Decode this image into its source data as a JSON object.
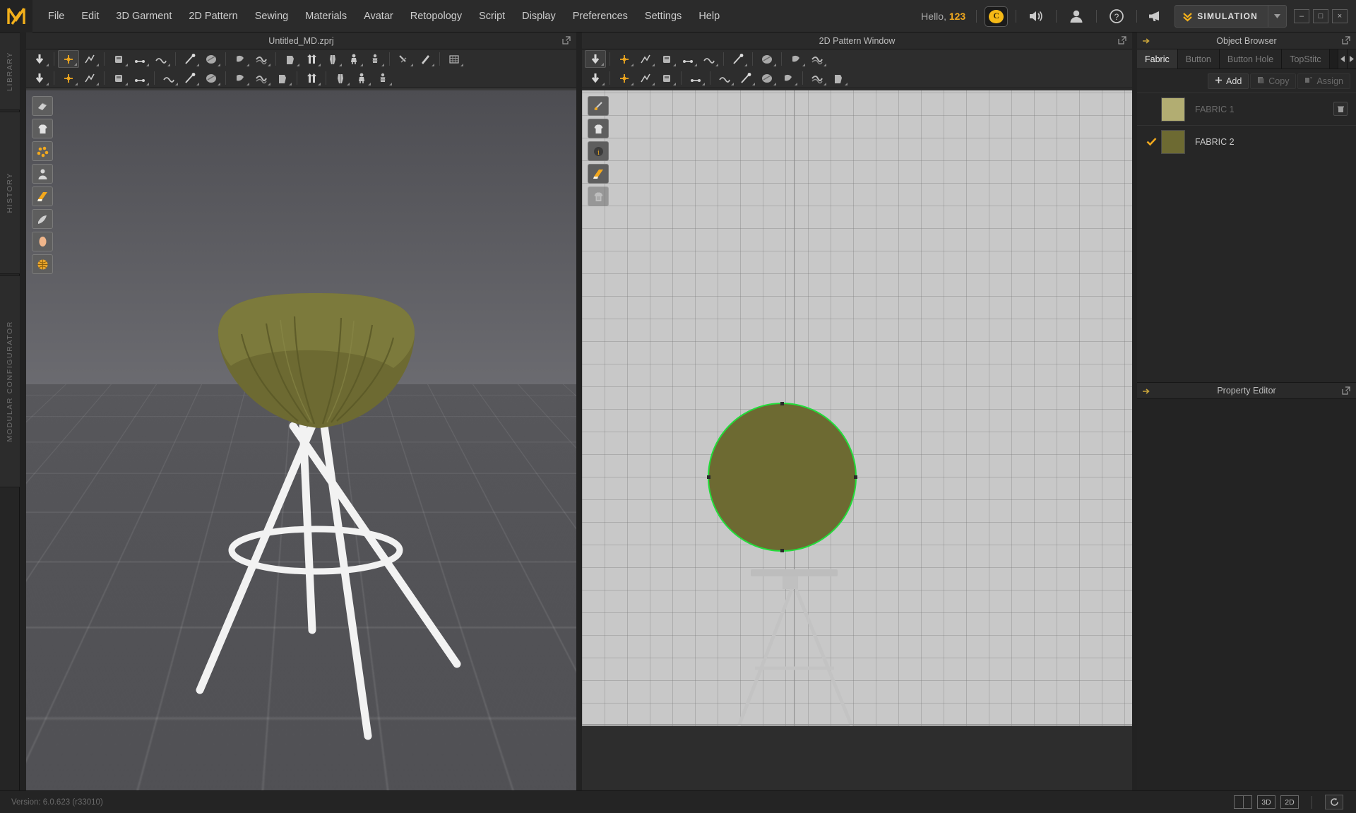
{
  "app": {
    "brand_icon": "marvelous-designer-logo",
    "accent_color": "#f0a81e",
    "version": "Version: 6.0.623 (r33010)"
  },
  "menubar": {
    "items": [
      {
        "label": "File"
      },
      {
        "label": "Edit"
      },
      {
        "label": "3D Garment"
      },
      {
        "label": "2D Pattern"
      },
      {
        "label": "Sewing"
      },
      {
        "label": "Materials"
      },
      {
        "label": "Avatar"
      },
      {
        "label": "Retopology"
      },
      {
        "label": "Script"
      },
      {
        "label": "Display"
      },
      {
        "label": "Preferences"
      },
      {
        "label": "Settings"
      },
      {
        "label": "Help"
      }
    ],
    "greeting_prefix": "Hello,",
    "username": "123",
    "coin_icon": "coin-icon",
    "volume_icon": "speaker-icon",
    "account_icon": "user-icon",
    "help_icon": "question-mark-icon",
    "notice_icon": "megaphone-icon",
    "mode_label": "SIMULATION",
    "mode_icon": "double-chevron-down-icon",
    "mode_dropdown_icon": "caret-down-icon",
    "window_minimize": "–",
    "window_maximize": "□",
    "window_close": "×"
  },
  "left_rail": {
    "tabs": [
      {
        "label": "LIBRARY",
        "name": "rail-library"
      },
      {
        "label": "HISTORY",
        "name": "rail-history"
      },
      {
        "label": "MODULAR CONFIGURATOR",
        "name": "rail-modular"
      }
    ]
  },
  "viewport_3d": {
    "title": "Untitled_MD.zprj",
    "popout_icon": "popout-icon",
    "tool_palette": [
      {
        "name": "show-hide-arrangement-points-icon"
      },
      {
        "name": "show-hide-garment-icon"
      },
      {
        "name": "show-hide-particle-distance-icon"
      },
      {
        "name": "show-hide-avatar-icon"
      },
      {
        "name": "show-hide-texture-surface-icon"
      },
      {
        "name": "show-hide-fabric-icon"
      },
      {
        "name": "show-hide-skin-icon"
      },
      {
        "name": "show-hide-uv-sphere-icon"
      }
    ],
    "toolbar_row1": [
      {
        "name": "simulate-icon"
      },
      {
        "name": "select-move-icon",
        "selected": true
      },
      {
        "name": "select-mesh-icon"
      },
      {
        "name": "pin-icon"
      },
      {
        "name": "fold-arrangement-icon"
      },
      {
        "name": "segment-sewing-icon"
      },
      {
        "name": "tack-icon"
      },
      {
        "name": "pressure-icon"
      },
      {
        "name": "layer-icon"
      },
      {
        "name": "flatten-icon"
      },
      {
        "name": "box-icon"
      },
      {
        "name": "arrow-up-icon"
      },
      {
        "name": "avatar-sizing-icon"
      },
      {
        "name": "avatar-pose-icon"
      },
      {
        "name": "avatar-measure-icon"
      },
      {
        "name": "scissors-icon"
      },
      {
        "name": "brush-icon"
      },
      {
        "name": "grid-icon"
      }
    ],
    "toolbar_row2": [
      {
        "name": "walk-pose-icon"
      },
      {
        "name": "skin-offset-icon"
      },
      {
        "name": "pen-avatar-icon"
      },
      {
        "name": "x-ray-joint-icon"
      },
      {
        "name": "bounding-volume-icon"
      },
      {
        "name": "zipper-icon"
      },
      {
        "name": "button-icon"
      },
      {
        "name": "buttonhole-icon"
      },
      {
        "name": "snap-icon"
      },
      {
        "name": "button-round-icon"
      },
      {
        "name": "lock-button-icon"
      },
      {
        "name": "zipper-slider-icon"
      },
      {
        "name": "plane-icon"
      },
      {
        "name": "ground-plane-icon"
      },
      {
        "name": "uv-editor-icon"
      }
    ]
  },
  "viewport_2d": {
    "title": "2D Pattern Window",
    "popout_icon": "popout-icon",
    "tool_palette": [
      {
        "name": "show-hide-internal-line-icon"
      },
      {
        "name": "show-hide-pattern-icon"
      },
      {
        "name": "show-hide-pattern-info-icon"
      },
      {
        "name": "show-hide-pattern-texture-icon"
      },
      {
        "name": "lock-pattern-icon",
        "disabled": true
      }
    ],
    "toolbar_row1": [
      {
        "name": "edit-pattern-icon",
        "selected": true
      },
      {
        "name": "edit-point-icon"
      },
      {
        "name": "transform-pattern-icon"
      },
      {
        "name": "ellipse-icon"
      },
      {
        "name": "rectangle-icon"
      },
      {
        "name": "polygon-icon"
      },
      {
        "name": "pleat-icon"
      },
      {
        "name": "avatar-link-icon"
      },
      {
        "name": "mesh-edit-icon"
      },
      {
        "name": "grid-pattern-icon"
      }
    ],
    "toolbar_row2": [
      {
        "name": "trace-icon"
      },
      {
        "name": "unfold-icon"
      },
      {
        "name": "symmetric-pattern-icon"
      },
      {
        "name": "search-pattern-icon"
      },
      {
        "name": "fold-arrangement-icon"
      },
      {
        "name": "segment-sewing-icon"
      },
      {
        "name": "free-sewing-icon"
      },
      {
        "name": "vertex-sewing-icon"
      },
      {
        "name": "m-n-sewing-icon"
      },
      {
        "name": "edit-sewing-icon"
      },
      {
        "name": "baseline-icon"
      }
    ],
    "pattern": {
      "shape": "circle",
      "fill_color": "#6d6a32",
      "outline_color": "#22dd3a",
      "selected": true
    },
    "avatar_silhouette": "stool-avatar-silhouette"
  },
  "object_browser": {
    "title": "Object Browser",
    "pin_icon": "pin-arrow-icon",
    "popout_icon": "popout-icon",
    "tabs": [
      {
        "label": "Fabric",
        "active": true
      },
      {
        "label": "Button",
        "active": false
      },
      {
        "label": "Button Hole",
        "active": false
      },
      {
        "label": "TopStitc",
        "active": false
      }
    ],
    "tab_prev_icon": "caret-left-icon",
    "tab_next_icon": "caret-right-icon",
    "actions": [
      {
        "label": "Add",
        "icon": "plus-icon",
        "enabled": true
      },
      {
        "label": "Copy",
        "icon": "copy-icon",
        "enabled": false
      },
      {
        "label": "Assign",
        "icon": "assign-icon",
        "enabled": false
      }
    ],
    "fabrics": [
      {
        "name": "FABRIC 1",
        "color": "#b2ad72",
        "selected": false,
        "has_delete": true,
        "delete_icon": "trash-icon"
      },
      {
        "name": "FABRIC 2",
        "color": "#6d6a32",
        "selected": true,
        "has_delete": false,
        "check_icon": "check-icon"
      }
    ]
  },
  "property_editor": {
    "title": "Property Editor",
    "pin_icon": "pin-arrow-icon",
    "popout_icon": "popout-icon"
  },
  "statusbar": {
    "version": "Version: 6.0.623 (r33010)",
    "buttons": [
      {
        "label": "",
        "name": "split-view-button",
        "icon": "split-view-icon"
      },
      {
        "label": "3D",
        "name": "view-3d-button"
      },
      {
        "label": "2D",
        "name": "view-2d-button"
      },
      {
        "label": "",
        "name": "reset-view-button",
        "icon": "refresh-icon"
      }
    ]
  }
}
